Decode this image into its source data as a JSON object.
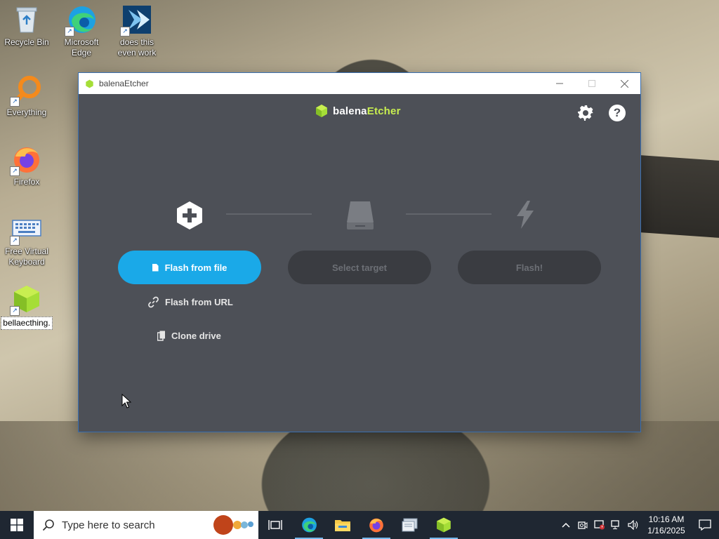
{
  "desktop": {
    "icons": [
      {
        "label": "Recycle Bin",
        "icon": "recycle-bin-icon"
      },
      {
        "label": "Microsoft Edge",
        "icon": "edge-icon"
      },
      {
        "label": "does this even work",
        "icon": "shortcut-app-icon"
      },
      {
        "label": "Everything",
        "icon": "everything-search-icon"
      },
      {
        "label": "Firefox",
        "icon": "firefox-icon"
      },
      {
        "label": "Free Virtual Keyboard",
        "icon": "keyboard-icon"
      },
      {
        "label": "bellaecthing.",
        "icon": "etcher-cube-icon"
      }
    ]
  },
  "window": {
    "title": "balenaEtcher",
    "brand_part1": "balena",
    "brand_part2": "Etcher",
    "steps": {
      "select_image_button": "Flash from file",
      "flash_from_url": "Flash from URL",
      "clone_drive": "Clone drive",
      "select_target_button": "Select target",
      "flash_button": "Flash!"
    }
  },
  "taskbar": {
    "search_placeholder": "Type here to search",
    "time": "10:16 AM",
    "date": "1/16/2025"
  },
  "colors": {
    "accent": "#1aa9e8",
    "window_bg": "#4d5057",
    "brand_green": "#c8ee50",
    "taskbar": "#1f2732"
  }
}
